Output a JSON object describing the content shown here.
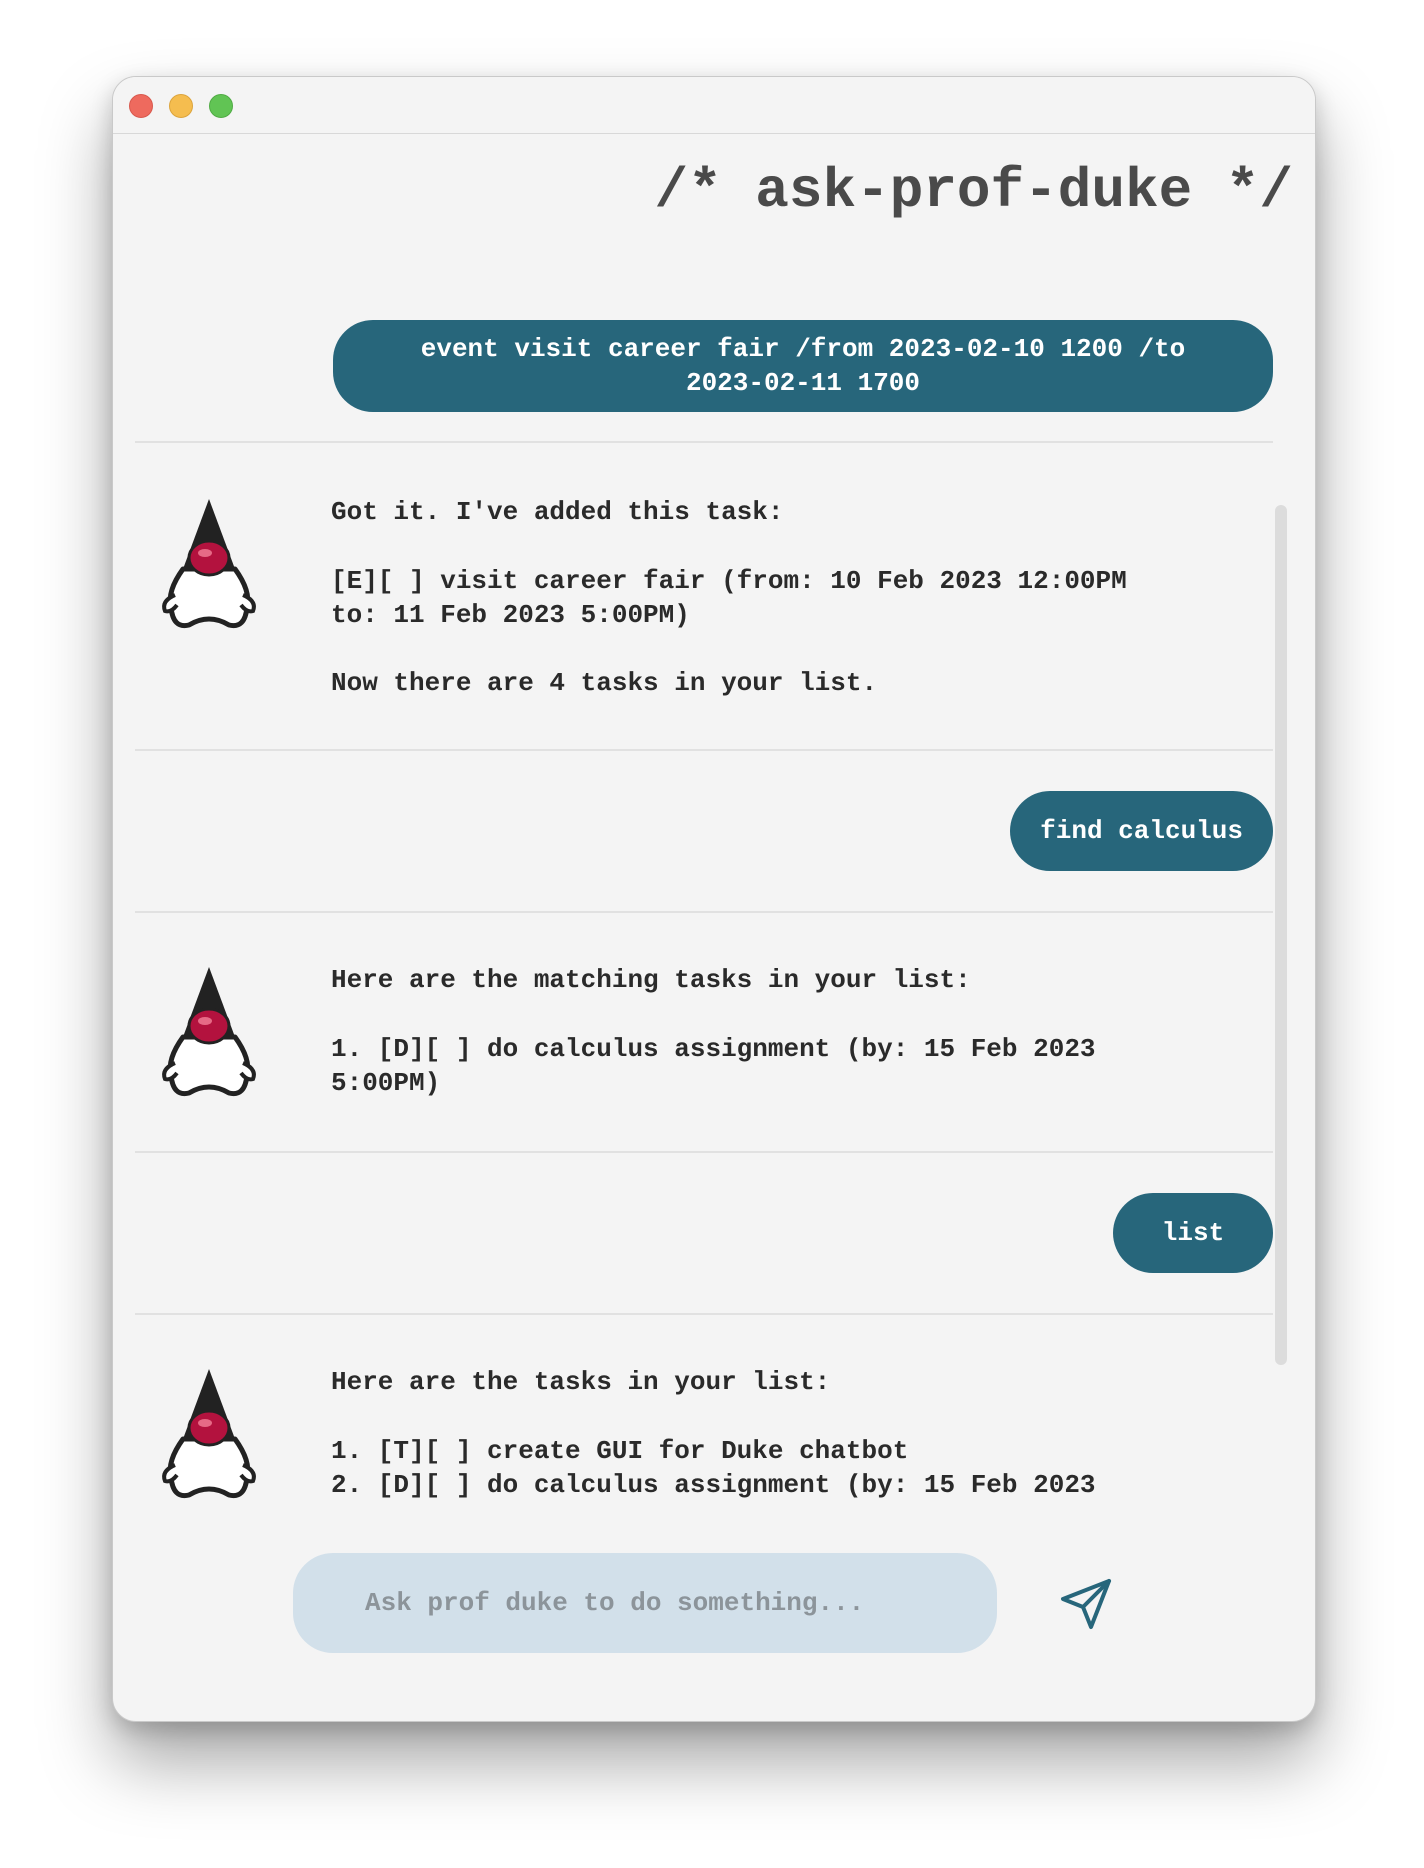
{
  "window": {
    "title": "/* ask-prof-duke */"
  },
  "messages": [
    {
      "sender": "user",
      "text": "event visit career fair /from 2023-02-10 1200 /to\n2023-02-11 1700"
    },
    {
      "sender": "bot",
      "text": "Got it. I've added this task:\n\n[E][ ] visit career fair (from: 10 Feb 2023 12:00PM\nto: 11 Feb 2023 5:00PM)\n\nNow there are 4 tasks in your list."
    },
    {
      "sender": "user",
      "text": "find calculus"
    },
    {
      "sender": "bot",
      "text": "Here are the matching tasks in your list:\n\n1. [D][ ] do calculus assignment (by: 15 Feb 2023\n5:00PM)"
    },
    {
      "sender": "user",
      "text": "list"
    },
    {
      "sender": "bot",
      "text": "Here are the tasks in your list:\n\n1. [T][ ] create GUI for Duke chatbot\n2. [D][ ] do calculus assignment (by: 15 Feb 2023"
    }
  ],
  "input": {
    "placeholder": "Ask prof duke to do something...",
    "value": ""
  },
  "icons": {
    "send": "send-icon",
    "avatar": "duke-mascot-icon"
  },
  "colors": {
    "user_bubble": "#27667b",
    "window_bg": "#f4f4f4",
    "input_bg": "#d2e0ea",
    "send_icon": "#27667b"
  }
}
